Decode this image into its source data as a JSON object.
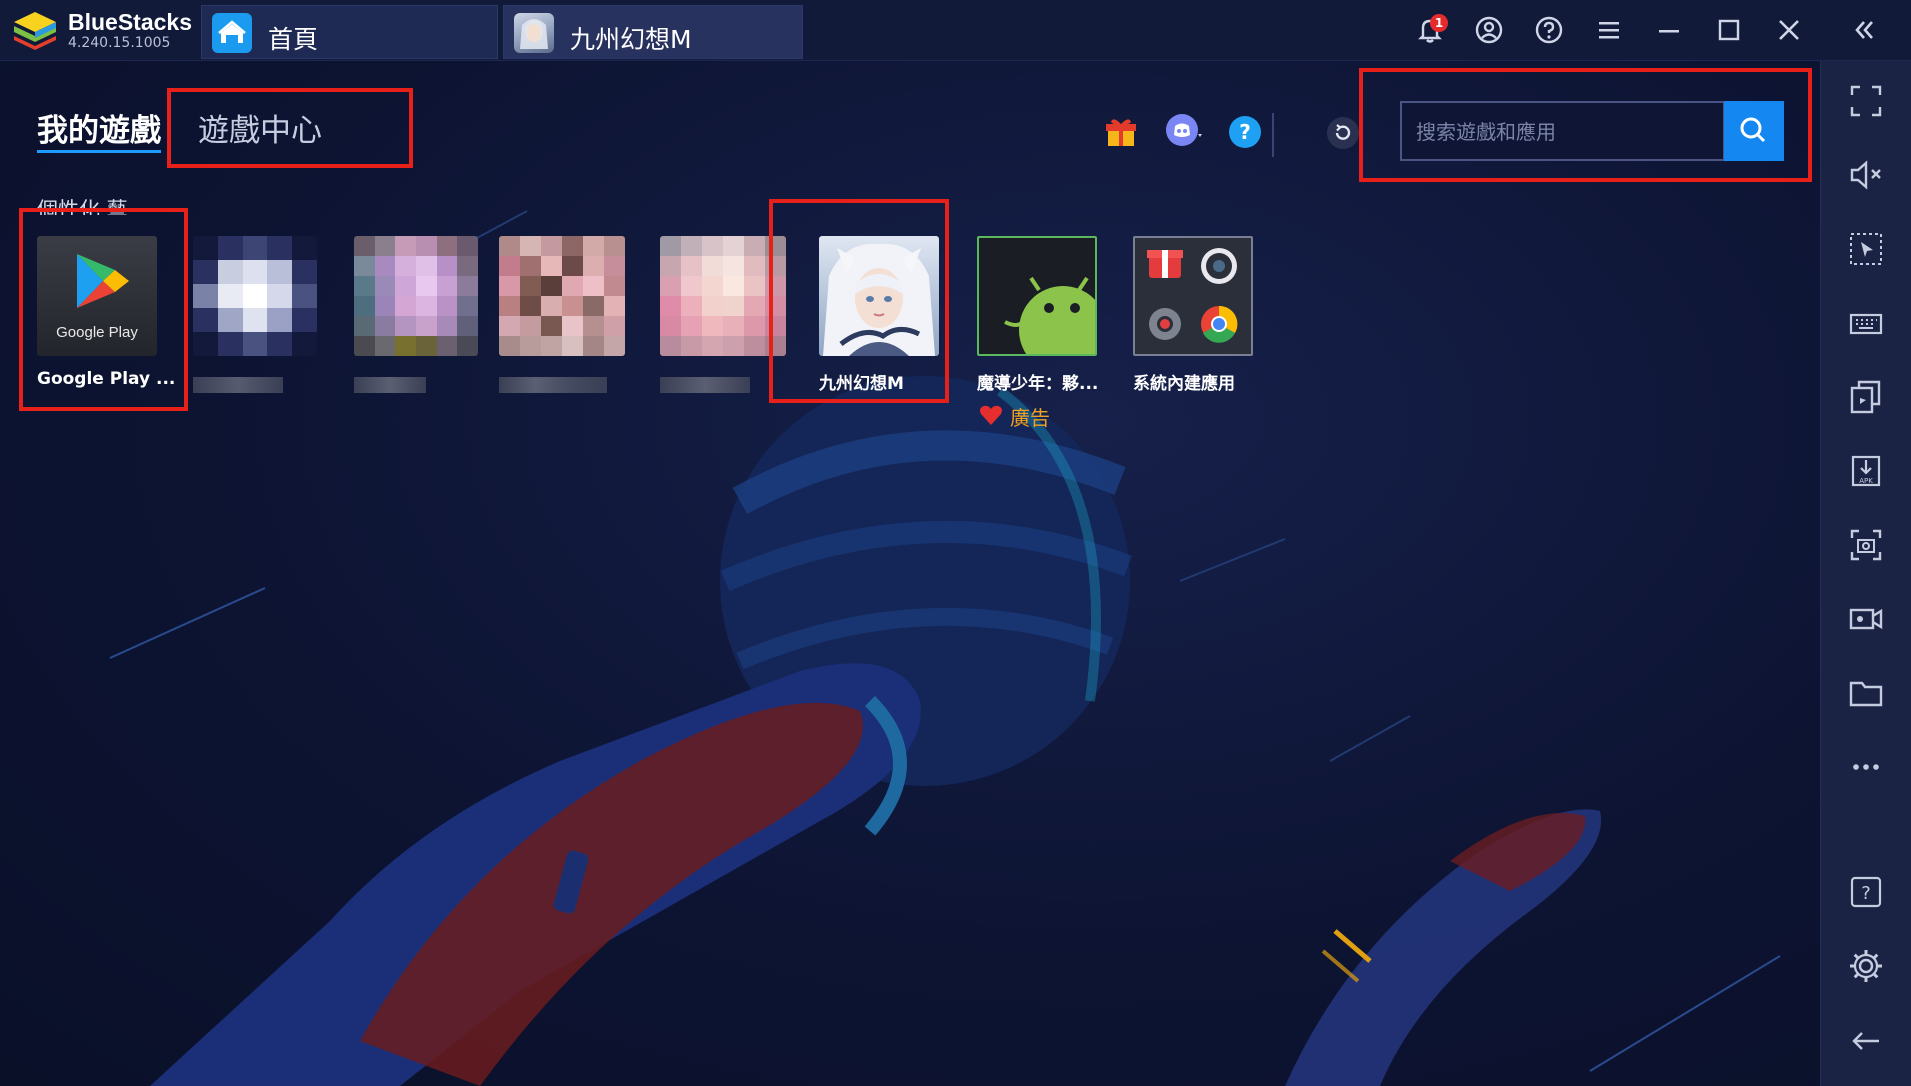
{
  "window": {
    "brand_name": "BlueStacks",
    "version": "4.240.15.1005",
    "tabs": [
      {
        "label": "首頁",
        "icon": "home-icon"
      },
      {
        "label": "九州幻想M",
        "icon": "game-avatar-icon"
      }
    ],
    "notification_count": "1",
    "controls": [
      "bell-icon",
      "account-icon",
      "help-icon",
      "menu-icon",
      "minimize-icon",
      "maximize-icon",
      "close-icon",
      "collapse-sidebar-icon"
    ]
  },
  "header": {
    "nav_mygames": "我的遊戲",
    "nav_gamecenter": "遊戲中心",
    "search": {
      "placeholder": "搜索遊戲和應用"
    },
    "icons": [
      "gift-icon",
      "discord-icon",
      "help-circle-icon",
      "refresh-icon",
      "search-icon"
    ]
  },
  "section_label": "個性化 藝",
  "apps": [
    {
      "name": "Google Play ...",
      "icon": "google-play-icon",
      "icon_caption": "Google Play"
    },
    {
      "name": "",
      "icon": "blurred-app-1-icon"
    },
    {
      "name": "",
      "icon": "blurred-app-2-icon"
    },
    {
      "name": "",
      "icon": "blurred-app-3-icon"
    },
    {
      "name": "",
      "icon": "blurred-app-4-icon"
    },
    {
      "name": "九州幻想M",
      "icon": "jiuzhou-game-icon"
    },
    {
      "name": "魔導少年：夥...",
      "icon": "android-icon"
    },
    {
      "name": "系統內建應用",
      "icon": "system-apps-icon"
    }
  ],
  "ad_label": "廣告",
  "sidebar": [
    "fullscreen-icon",
    "mute-icon",
    "pointer-icon",
    "keyboard-icon",
    "multi-instance-icon",
    "apk-install-icon",
    "screenshot-icon",
    "record-icon",
    "folder-icon",
    "more-icon",
    "help-box-icon",
    "settings-icon",
    "back-icon"
  ],
  "colors": {
    "accent": "#1487f0",
    "highlight": "#e8201a",
    "background": "#0b1230",
    "ad": "#f2a020"
  }
}
